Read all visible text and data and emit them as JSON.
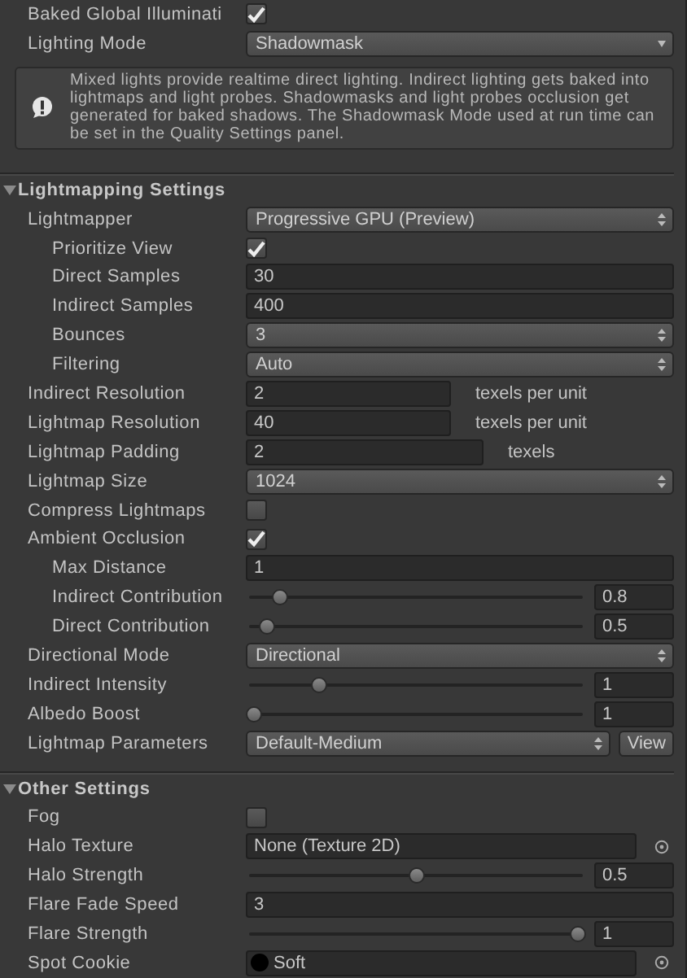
{
  "top_rows": [
    {
      "kind": "checkbox",
      "label": "Baked Global Illuminati",
      "checked": true
    },
    {
      "kind": "dropdown",
      "label": "Lighting Mode",
      "value": "Shadowmask"
    }
  ],
  "help_box": {
    "text": "Mixed lights provide realtime direct lighting. Indirect lighting gets baked into lightmaps and light probes. Shadowmasks and light probes occlusion get generated for baked shadows. The Shadowmask Mode used at run time can be set in the Quality Settings panel."
  },
  "sections": [
    {
      "title": "Lightmapping Settings",
      "expanded": true,
      "rows": [
        {
          "kind": "dropdown",
          "label": "Lightmapper",
          "value": "Progressive GPU (Preview)",
          "children": [
            {
              "kind": "checkbox",
              "label": "Prioritize View",
              "checked": true
            },
            {
              "kind": "field",
              "label": "Direct Samples",
              "value": "30"
            },
            {
              "kind": "field",
              "label": "Indirect Samples",
              "value": "400"
            },
            {
              "kind": "dropdown",
              "label": "Bounces",
              "value": "3"
            },
            {
              "kind": "dropdown",
              "label": "Filtering",
              "value": "Auto"
            }
          ]
        },
        {
          "kind": "field_unit",
          "label": "Indirect Resolution",
          "value": "2",
          "unit": "texels per unit"
        },
        {
          "kind": "field_unit",
          "label": "Lightmap Resolution",
          "value": "40",
          "unit": "texels per unit"
        },
        {
          "kind": "field_unit",
          "label": "Lightmap Padding",
          "value": "2",
          "unit": "texels"
        },
        {
          "kind": "dropdown",
          "label": "Lightmap Size",
          "value": "1024"
        },
        {
          "kind": "checkbox",
          "label": "Compress Lightmaps",
          "checked": false
        },
        {
          "kind": "checkbox",
          "label": "Ambient Occlusion",
          "checked": true,
          "children": [
            {
              "kind": "field",
              "label": "Max Distance",
              "value": "1"
            },
            {
              "kind": "slider",
              "label": "Indirect Contribution",
              "level": 0.08,
              "value": "0.8"
            },
            {
              "kind": "slider",
              "label": "Direct Contribution",
              "level": 0.04,
              "value": "0.5"
            }
          ]
        },
        {
          "kind": "dropdown",
          "label": "Directional Mode",
          "value": "Directional"
        },
        {
          "kind": "slider",
          "label": "Indirect Intensity",
          "level": 0.2,
          "value": "1"
        },
        {
          "kind": "slider",
          "label": "Albedo Boost",
          "level": 0,
          "value": "1"
        },
        {
          "kind": "dropdown_button",
          "label": "Lightmap Parameters",
          "value": "Default-Medium",
          "button": "View"
        }
      ]
    },
    {
      "title": "Other Settings",
      "expanded": true,
      "rows": [
        {
          "kind": "checkbox",
          "label": "Fog",
          "checked": false
        },
        {
          "kind": "object",
          "label": "Halo Texture",
          "value": "None (Texture 2D)",
          "preview": false
        },
        {
          "kind": "slider",
          "label": "Halo Strength",
          "level": 0.5,
          "value": "0.5"
        },
        {
          "kind": "field",
          "label": "Flare Fade Speed",
          "value": "3"
        },
        {
          "kind": "slider",
          "label": "Flare Strength",
          "level": 1,
          "value": "1"
        },
        {
          "kind": "object",
          "label": "Spot Cookie",
          "value": "Soft",
          "preview": true
        }
      ]
    }
  ]
}
